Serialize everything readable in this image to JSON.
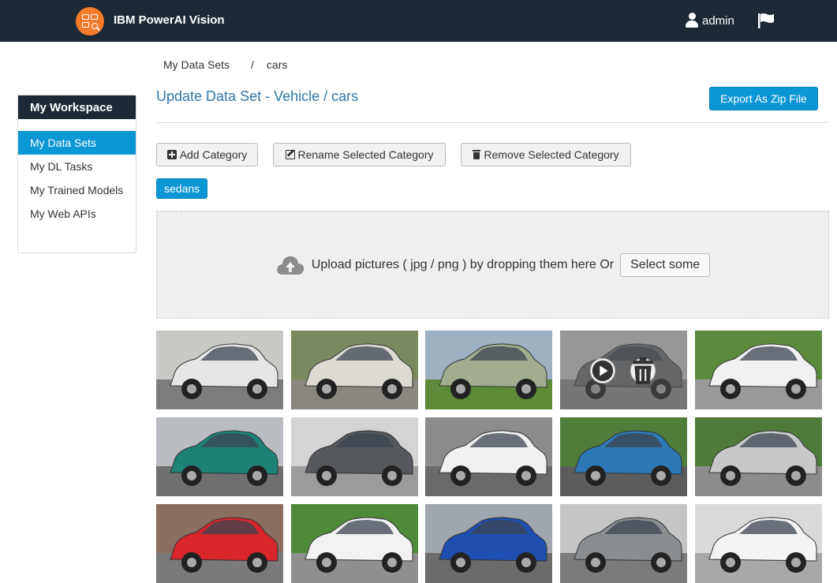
{
  "navbar": {
    "brand": "IBM PowerAI Vision",
    "user": "admin"
  },
  "breadcrumb": {
    "root": "My Data Sets",
    "separator": "/",
    "current": "cars"
  },
  "sidebar": {
    "title": "My Workspace",
    "items": [
      {
        "label": "My Data Sets",
        "active": true
      },
      {
        "label": "My DL Tasks",
        "active": false
      },
      {
        "label": "My Trained Models",
        "active": false
      },
      {
        "label": "My Web APIs",
        "active": false
      }
    ]
  },
  "main": {
    "title": "Update Data Set - Vehicle / cars",
    "export_label": "Export As Zip File",
    "buttons": {
      "add": "Add Category",
      "rename": "Rename Selected Category",
      "remove": "Remove Selected Category"
    },
    "category_tag": "sedans",
    "dropzone": {
      "text": "Upload pictures ( jpg / png ) by dropping them here Or",
      "select_label": "Select some"
    }
  },
  "colors": {
    "navbar": "#1d2a35",
    "accent": "#0b96d4",
    "logo": "#f47b2a",
    "title": "#2f76a9"
  },
  "images": [
    {
      "car": "white hatchback",
      "color": "#e6e6e6",
      "bg": "#c7c9c4",
      "ground": "#7d7d7d"
    },
    {
      "car": "white Volvo sedan",
      "color": "#dcdad2",
      "bg": "#7a8a5e",
      "ground": "#8a8780"
    },
    {
      "car": "green Pontiac",
      "color": "#a2ad90",
      "bg": "#9fb0c2",
      "ground": "#5e8a3a"
    },
    {
      "car": "grey Mercedes (hovered)",
      "color": "#6c6f72",
      "bg": "#c9c9c9",
      "ground": "#8c8c8c"
    },
    {
      "car": "white BMW",
      "color": "#f0f0f0",
      "bg": "#5b8a3d",
      "ground": "#9a9a9a"
    },
    {
      "car": "teal sedan",
      "color": "#1f8277",
      "bg": "#b9bcc0",
      "ground": "#6f6f6f"
    },
    {
      "car": "dark Jaguar",
      "color": "#55585c",
      "bg": "#d4d4d4",
      "ground": "#9b9b9b"
    },
    {
      "car": "white Jaguar",
      "color": "#f1f1f1",
      "bg": "#8c8c8c",
      "ground": "#6a6a6a"
    },
    {
      "car": "blue classic sedan",
      "color": "#2e78b5",
      "bg": "#4f7d3a",
      "ground": "#5c5c5c"
    },
    {
      "car": "silver sedan",
      "color": "#c6c8c9",
      "bg": "#4e7b3a",
      "ground": "#8c8c8c"
    },
    {
      "car": "red hatchback",
      "color": "#d8262b",
      "bg": "#8a6f5e",
      "ground": "#7a7a7a"
    },
    {
      "car": "white VW Golf",
      "color": "#f2f2f2",
      "bg": "#4e8a3a",
      "ground": "#8f8f8f"
    },
    {
      "car": "blue hatchback",
      "color": "#1e4fb0",
      "bg": "#9fa6ad",
      "ground": "#6b6b6b"
    },
    {
      "car": "grey hatchback",
      "color": "#8b8e91",
      "bg": "#c4c6c4",
      "ground": "#7b7b7b"
    },
    {
      "car": "white Citroen",
      "color": "#f4f4f4",
      "bg": "#d9d9d9",
      "ground": "#a8a8a8"
    }
  ]
}
